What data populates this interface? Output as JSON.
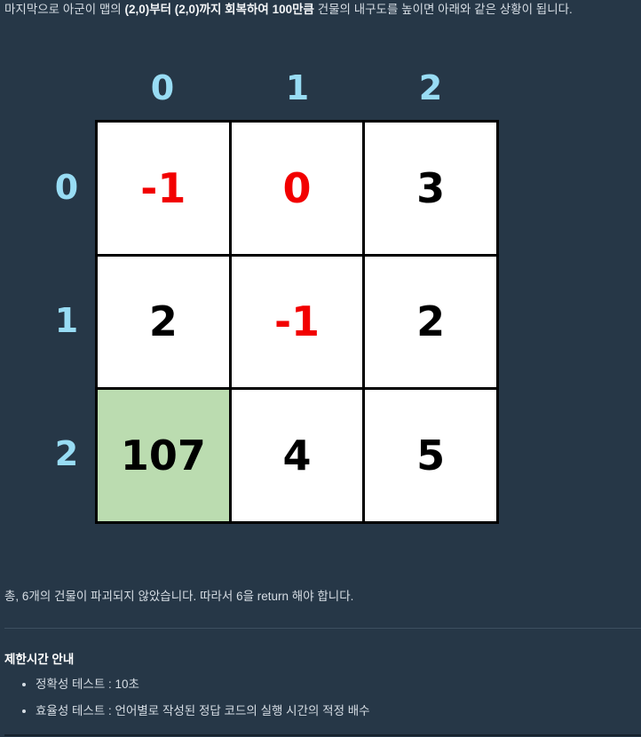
{
  "intro": {
    "part1": "마지막으로 아군이 맵의 ",
    "bold1": "(2,0)부터 (2,0)까지 회복하여 100만큼",
    "part2": " 건물의 내구도를 높이면 아래와 같은 상황이 됩니다."
  },
  "grid": {
    "col_labels": [
      "0",
      "1",
      "2"
    ],
    "row_labels": [
      "0",
      "1",
      "2"
    ],
    "cells": [
      [
        "-1",
        "0",
        "3"
      ],
      [
        "2",
        "-1",
        "2"
      ],
      [
        "107",
        "4",
        "5"
      ]
    ],
    "colors": {
      "negative": "#f20000",
      "normal": "#000000",
      "highlight_bg": "#bbdcb0",
      "label": "#98dcf4"
    }
  },
  "summary": "총, 6개의 건물이 파괴되지 않았습니다. 따라서 6을 return 해야 합니다.",
  "time_limits": {
    "title": "제한시간 안내",
    "items": [
      "정확성 테스트 : 10초",
      "효율성 테스트 : 언어별로 작성된 정답 코드의 실행 시간의 적정 배수"
    ]
  }
}
